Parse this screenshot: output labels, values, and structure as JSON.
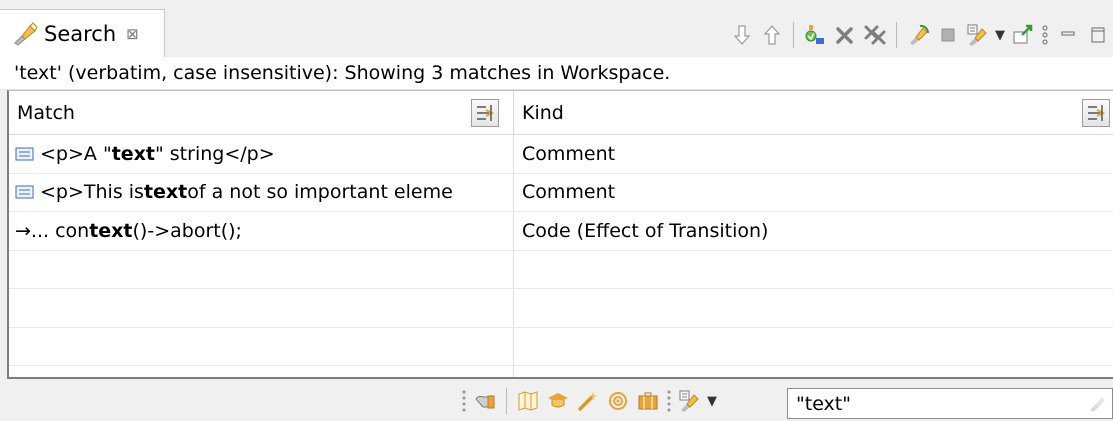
{
  "view": {
    "tab_label": "Search",
    "tab_close": "⊠"
  },
  "status_line": "'text' (verbatim, case insensitive): Showing 3 matches in Workspace.",
  "table": {
    "headers": {
      "match": "Match",
      "kind": "Kind"
    },
    "rows": [
      {
        "icon": "comment-icon",
        "pre": "<p>A \"",
        "bold": "text",
        "post": "\" string</p>",
        "kind": "Comment"
      },
      {
        "icon": "comment-icon",
        "pre": "<p>This is ",
        "bold": "text",
        "post": " of a not so important eleme",
        "kind": "Comment"
      },
      {
        "icon": "transition-arrow-icon",
        "pre": "→... con",
        "bold": "text",
        "post": "()->abort();",
        "kind": "Code (Effect of Transition)"
      }
    ]
  },
  "search_field": {
    "value": "\"text\""
  },
  "icons": {
    "toolbar": [
      "next-match-icon",
      "previous-match-icon",
      "show-in-browser-icon",
      "remove-match-icon",
      "remove-all-matches-icon",
      "refresh-icon",
      "stop-icon",
      "search-history-icon",
      "pin-icon",
      "view-menu-icon",
      "minimize-icon",
      "maximize-icon"
    ],
    "bottom": [
      "filter-icon",
      "book-icon",
      "education-icon",
      "wand-icon",
      "target-icon",
      "briefcase-icon",
      "search-history-icon"
    ]
  },
  "colors": {
    "accent_orange": "#e8a33a",
    "accent_green": "#3a9a3a",
    "accent_red": "#cc3333",
    "accent_blue": "#3a6ec8"
  }
}
